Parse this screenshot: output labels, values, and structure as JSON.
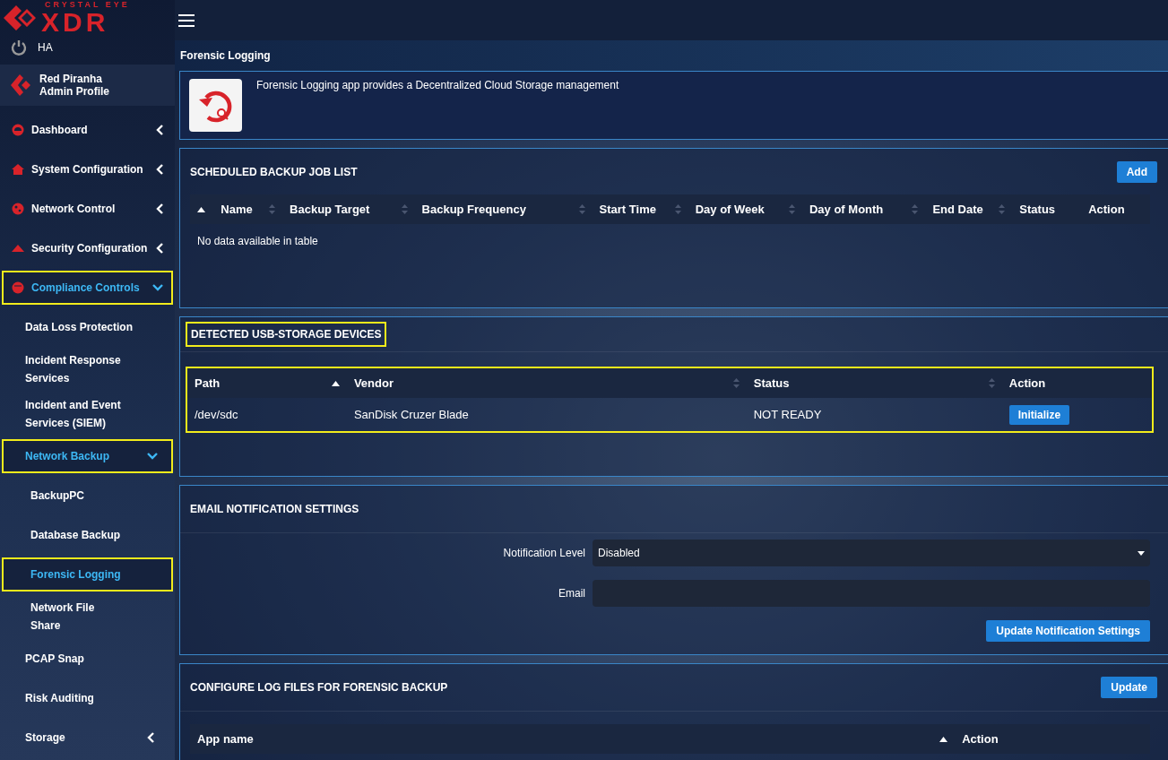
{
  "logo": {
    "tagline": "CRYSTAL EYE",
    "name": "XDR"
  },
  "sidebar": {
    "ha": {
      "label": "HA"
    },
    "profile": {
      "name": "Red Piranha",
      "role": "Admin Profile"
    },
    "items": [
      {
        "label": "Dashboard",
        "expanded": false,
        "highlighted": false,
        "selected": false
      },
      {
        "label": "System Configuration",
        "expanded": false,
        "highlighted": false,
        "selected": false
      },
      {
        "label": "Network Control",
        "expanded": false,
        "highlighted": false,
        "selected": false
      },
      {
        "label": "Security Configuration",
        "expanded": false,
        "highlighted": false,
        "selected": false
      },
      {
        "label": "Compliance Controls",
        "expanded": true,
        "highlighted": true,
        "selected": true,
        "children": [
          {
            "label": "Data Loss Protection",
            "highlighted": false,
            "selected": false
          },
          {
            "label": "Incident Response Services",
            "highlighted": false,
            "selected": false
          },
          {
            "label": "Incident and Event Services (SIEM)",
            "highlighted": false,
            "selected": false
          },
          {
            "label": "Network Backup",
            "expanded": true,
            "highlighted": true,
            "selected": true,
            "children": [
              {
                "label": "BackupPC",
                "highlighted": false,
                "selected": false
              },
              {
                "label": "Database Backup",
                "highlighted": false,
                "selected": false
              },
              {
                "label": "Forensic Logging",
                "highlighted": true,
                "selected": true
              },
              {
                "label": "Network File Share",
                "highlighted": false,
                "selected": false
              }
            ]
          },
          {
            "label": "PCAP Snap",
            "highlighted": false,
            "selected": false
          },
          {
            "label": "Risk Auditing",
            "highlighted": false,
            "selected": false
          },
          {
            "label": "Storage",
            "expanded": false,
            "highlighted": false,
            "selected": false
          }
        ]
      }
    ]
  },
  "page_title": "Forensic Logging",
  "app_info": {
    "description": "Forensic Logging app provides a Decentralized Cloud Storage management"
  },
  "scheduled_backup": {
    "title": "SCHEDULED BACKUP JOB LIST",
    "button": "Add",
    "columns": [
      {
        "sortable": true,
        "sorted_ascending": true
      },
      {
        "label": "Name",
        "sortable": true,
        "sorted_ascending": false
      },
      {
        "label": "Backup Target",
        "sortable": true,
        "sorted_ascending": false
      },
      {
        "label": "Backup Frequency",
        "sortable": true,
        "sorted_ascending": false
      },
      {
        "label": "Start Time",
        "sortable": true,
        "sorted_ascending": false
      },
      {
        "label": "Day of Week",
        "sortable": true,
        "sorted_ascending": false
      },
      {
        "label": "Day of Month",
        "sortable": true,
        "sorted_ascending": false
      },
      {
        "label": "End Date",
        "sortable": true,
        "sorted_ascending": false
      },
      {
        "label": "Status",
        "sortable": false
      },
      {
        "label": "Action",
        "sortable": false
      }
    ],
    "empty_message": "No data available in table"
  },
  "usb_devices": {
    "title": "DETECTED USB-STORAGE DEVICES",
    "highlighted": true,
    "columns": [
      {
        "label": "Path",
        "sortable": true,
        "sorted_ascending": true
      },
      {
        "label": "Vendor",
        "sortable": true,
        "sorted_ascending": false
      },
      {
        "label": "Status",
        "sortable": true,
        "sorted_ascending": false
      },
      {
        "label": "Action",
        "sortable": false
      }
    ],
    "rows": [
      {
        "path": "/dev/sdc",
        "vendor": "SanDisk Cruzer Blade",
        "status": "NOT READY",
        "action": "Initialize"
      }
    ]
  },
  "email_settings": {
    "title": "EMAIL NOTIFICATION SETTINGS",
    "fields": [
      {
        "kind": "select",
        "label": "Notification Level",
        "value": "Disabled"
      },
      {
        "kind": "text",
        "label": "Email"
      }
    ],
    "button": "Update Notification Settings"
  },
  "log_files": {
    "title": "CONFIGURE LOG FILES FOR FORENSIC BACKUP",
    "button": "Update",
    "columns": [
      {
        "label": "App name",
        "sortable": true,
        "sorted_ascending": true
      },
      {
        "label": "Action",
        "sortable": false
      }
    ]
  }
}
